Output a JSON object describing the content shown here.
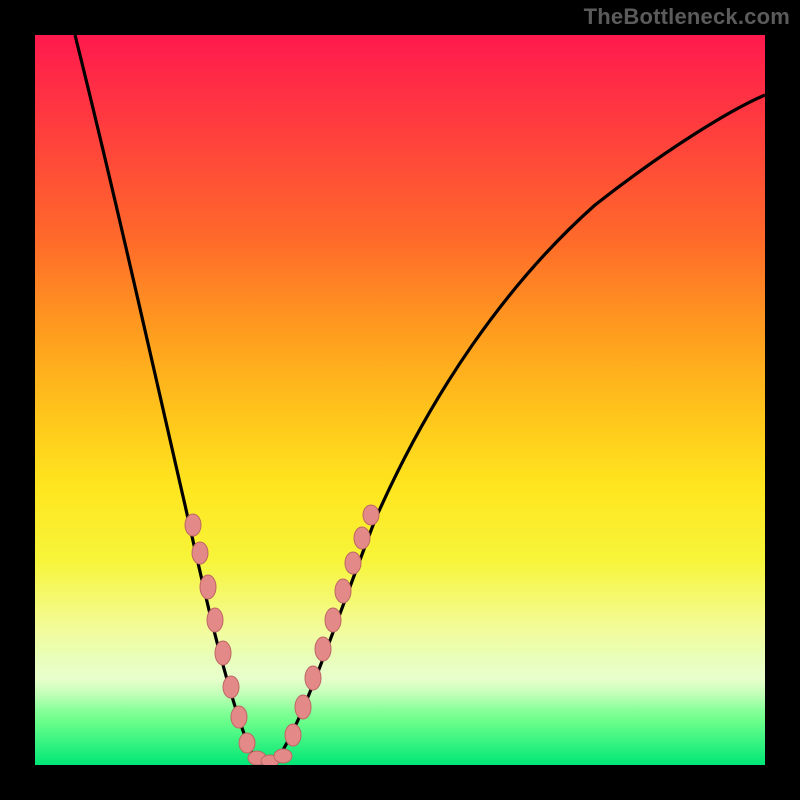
{
  "watermark": "TheBottleneck.com",
  "colors": {
    "curve_stroke": "#000000",
    "marker_fill": "#e38a88",
    "marker_stroke": "#be6664",
    "background": "#000000"
  },
  "chart_data": {
    "type": "line",
    "title": "",
    "xlabel": "",
    "ylabel": "",
    "xlim": [
      0,
      100
    ],
    "ylim": [
      0,
      100
    ],
    "series": [
      {
        "name": "bottleneck-curve",
        "x": [
          5,
          10,
          15,
          18,
          20,
          22,
          24,
          26,
          28,
          30,
          32,
          34,
          36,
          40,
          45,
          50,
          55,
          60,
          65,
          70,
          75,
          80,
          85,
          90,
          95,
          100
        ],
        "y": [
          100,
          85,
          68,
          55,
          46,
          36,
          25,
          13,
          4,
          0,
          0,
          2,
          6,
          16,
          28,
          38,
          46,
          53,
          59,
          64,
          68,
          72,
          75,
          78,
          80,
          82
        ]
      }
    ],
    "markers": {
      "name": "highlighted-points",
      "x": [
        21,
        22.5,
        23.5,
        24.5,
        25.5,
        27,
        28,
        29,
        30,
        31,
        32,
        33,
        34,
        35,
        36,
        37,
        38.5,
        40,
        41.5,
        43
      ],
      "y": [
        40,
        33,
        26,
        20,
        14,
        6,
        3,
        1,
        0,
        0,
        1,
        2,
        4,
        7,
        10,
        14,
        18,
        22,
        26,
        30
      ]
    },
    "gradient_stops": [
      {
        "pos": 0,
        "color": "#ff1a4d"
      },
      {
        "pos": 28,
        "color": "#ff6a2a"
      },
      {
        "pos": 52,
        "color": "#ffc51b"
      },
      {
        "pos": 72,
        "color": "#f7f53a"
      },
      {
        "pos": 94,
        "color": "#6bff8a"
      },
      {
        "pos": 100,
        "color": "#00e676"
      }
    ]
  }
}
